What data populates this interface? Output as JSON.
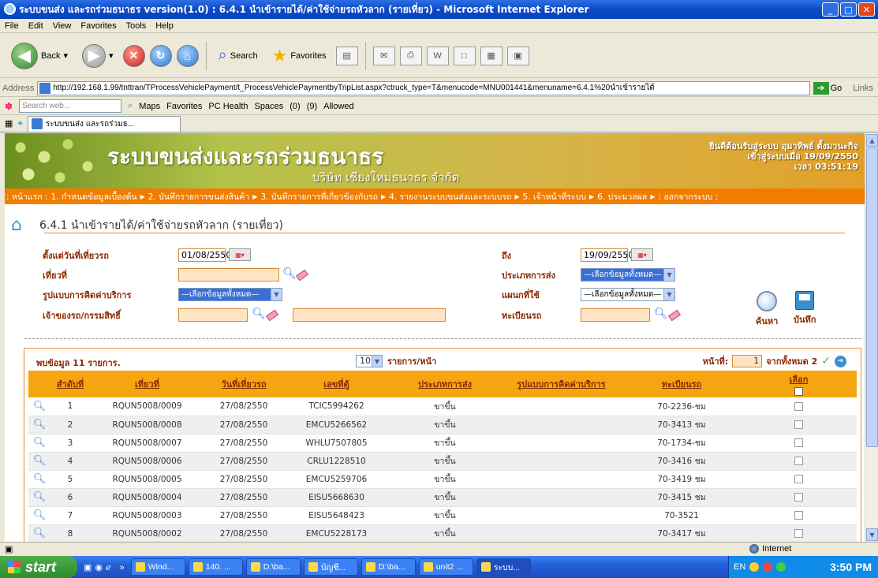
{
  "window": {
    "title": "ระบบขนส่ง และรถร่วมธนาธร version(1.0) : 6.4.1 นำเข้ารายได้/ค่าใช้จ่ายรถหัวลาก (รายเที่ยว) - Microsoft Internet Explorer"
  },
  "menu": [
    "File",
    "Edit",
    "View",
    "Favorites",
    "Tools",
    "Help"
  ],
  "toolbar": {
    "back": "Back",
    "search": "Search",
    "favorites": "Favorites"
  },
  "address": {
    "label": "Address",
    "url": "http://192.168.1.99/tnttran/TProcessVehiclePayment/t_ProcessVehiclePaymentbyTripList.aspx?ctruck_type=T&menucode=MNU001441&menuname=6.4.1%20นำเข้ารายได้",
    "go": "Go",
    "links": "Links"
  },
  "searchbar": {
    "placeholder": "Search web...",
    "maps": "Maps",
    "favorites": "Favorites",
    "pchealth": "PC Health",
    "spaces": "Spaces",
    "mail": "(0)",
    "msn": "(9)",
    "allowed": "Allowed"
  },
  "tab": {
    "label": "ระบบขนส่ง และรถร่วมธ..."
  },
  "header": {
    "brand": "ระบบขนส่งและรถร่วมธนาธร",
    "company": "บริษัท เชียงใหม่ธนาธร จำกัด",
    "welcome_line1": "ยินดีต้อนรับสู่ระบบ อุมาทิพย์ ตั้งมานะกิจ",
    "welcome_line2": "เข้าสู่ระบบเมื่อ 19/09/2550",
    "welcome_line3": "เวลา 03:51:19"
  },
  "nav": [
    ": หน้าแรก :",
    "1. กำหนดข้อมูลเบื้องต้น",
    "2. บันทึกรายการขนส่งสินค้า",
    "3. บันทึกรายการที่เกี่ยวข้องกับรถ",
    "4. รายงานระบบขนส่งและระบบรถ",
    "5. เจ้าหน้าที่ระบบ",
    "6. ประมวลผล",
    ": ออกจากระบบ :"
  ],
  "page": {
    "title": "6.4.1 นำเข้ารายได้/ค่าใช้จ่ายรถหัวลาก (รายเที่ยว)"
  },
  "form": {
    "from_label": "ตั้งแต่วันที่เที่ยวรถ",
    "from_value": "01/08/2550",
    "to_label": "ถึง",
    "to_value": "19/09/2550",
    "trip_label": "เที่ยวที่",
    "ship_type_label": "ประเภทการส่ง",
    "ship_type_value": "—เลือกข้อมูลทั้งหมด—",
    "service_label": "รูปแบบการคิดค่าบริการ",
    "service_value": "—เลือกข้อมูลทั้งหมด—",
    "dept_label": "แผนกที่ใช้",
    "dept_value": "—เลือกข้อมูลทั้งหมด—",
    "owner_label": "เจ้าของรถ/กรรมสิทธิ์",
    "plate_label": "ทะเบียนรถ",
    "search_button": "ค้นหา",
    "save_button": "บันทึก"
  },
  "grid": {
    "found": "พบข้อมูล 11 รายการ.",
    "page_size": "10",
    "per_page": "รายการ/หน้า",
    "page_label": "หน้าที่:",
    "page_value": "1",
    "page_total": "จากทั้งหมด 2",
    "headers": [
      "สำดับที่",
      "เที่ยวที่",
      "วันที่เที่ยวรถ",
      "เลขที่ตู้",
      "ประเภทการส่ง",
      "รูปแบบการคิดค่าบริการ",
      "ทะเบียนรถ",
      "เลือก"
    ],
    "rows": [
      {
        "no": "1",
        "trip": "RQUN5008/0009",
        "date": "27/08/2550",
        "container": "TCIC5994262",
        "type": "ขาขึ้น",
        "service": "",
        "plate": "70-2236-ชม"
      },
      {
        "no": "2",
        "trip": "RQUN5008/0008",
        "date": "27/08/2550",
        "container": "EMCU5266562",
        "type": "ขาขึ้น",
        "service": "",
        "plate": "70-3413 ชม"
      },
      {
        "no": "3",
        "trip": "RQUN5008/0007",
        "date": "27/08/2550",
        "container": "WHLU7507805",
        "type": "ขาขึ้น",
        "service": "",
        "plate": "70-1734-ชม"
      },
      {
        "no": "4",
        "trip": "RQUN5008/0006",
        "date": "27/08/2550",
        "container": "CRLU1228510",
        "type": "ขาขึ้น",
        "service": "",
        "plate": "70-3416 ชม"
      },
      {
        "no": "5",
        "trip": "RQUN5008/0005",
        "date": "27/08/2550",
        "container": "EMCU5259706",
        "type": "ขาขึ้น",
        "service": "",
        "plate": "70-3419 ชม"
      },
      {
        "no": "6",
        "trip": "RQUN5008/0004",
        "date": "27/08/2550",
        "container": "EISU5668630",
        "type": "ขาขึ้น",
        "service": "",
        "plate": "70-3415 ชม"
      },
      {
        "no": "7",
        "trip": "RQUN5008/0003",
        "date": "27/08/2550",
        "container": "EISU5648423",
        "type": "ขาขึ้น",
        "service": "",
        "plate": "70-3521"
      },
      {
        "no": "8",
        "trip": "RQUN5008/0002",
        "date": "27/08/2550",
        "container": "EMCU5228173",
        "type": "ขาขึ้น",
        "service": "",
        "plate": "70-3417 ชม"
      }
    ]
  },
  "status": {
    "zone": "Internet"
  },
  "taskbar": {
    "start": "start",
    "items": [
      "Wind...",
      "140. ...",
      "D:\\ba...",
      "บัญชี...",
      "D:\\ba...",
      "unit2 ...",
      "ระบบ..."
    ],
    "lang": "EN",
    "clock": "3:50 PM"
  }
}
